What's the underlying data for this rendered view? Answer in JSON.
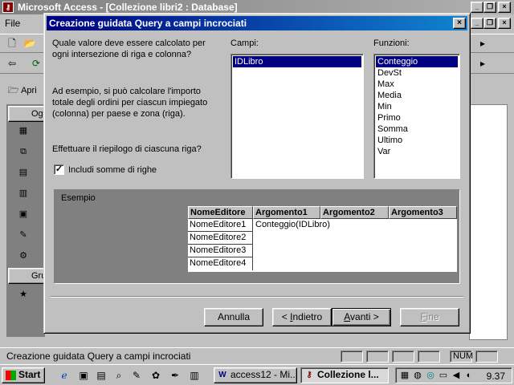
{
  "app": {
    "title": "Microsoft Access - [Collezione libri2 : Database]",
    "menu_file": "File",
    "open_label": "Apri",
    "obj_header": "Ogg",
    "groups_header": "Gru",
    "objects": [
      "T",
      "Q",
      "M",
      "R",
      "P",
      "M",
      "M"
    ],
    "group_item": "P",
    "status_text": "Creazione guidata Query a campi incrociati",
    "status_num": "NUM"
  },
  "wizard": {
    "title": "Creazione guidata Query a campi incrociati",
    "question": "Quale valore deve essere calcolato per ogni intersezione di riga e colonna?",
    "example_text": "Ad esempio, si può calcolare l'importo totale degli ordini per ciascun impiegato (colonna) per paese e zona (riga).",
    "summary_question": "Effettuare il riepilogo di ciascuna riga?",
    "checkbox_label": "Includi somme di righe",
    "checkbox_checked": true,
    "fields_label": "Campi:",
    "fields": [
      "IDLibro"
    ],
    "functions_label": "Funzioni:",
    "functions": [
      "Conteggio",
      "DevSt",
      "Max",
      "Media",
      "Min",
      "Primo",
      "Somma",
      "Ultimo",
      "Var"
    ],
    "example_label": "Esempio",
    "table_headers": [
      "NomeEditore",
      "Argomento1",
      "Argomento2",
      "Argomento3"
    ],
    "table_rows": [
      "NomeEditore1",
      "NomeEditore2",
      "NomeEditore3",
      "NomeEditore4"
    ],
    "table_value": "Conteggio(IDLibro)",
    "buttons": {
      "cancel": "Annulla",
      "back": "< Indietro",
      "next": "Avanti >",
      "finish": "Fine"
    }
  },
  "taskbar": {
    "start": "Start",
    "tasks": [
      "access12 - Mi...",
      "Collezione l..."
    ],
    "clock": "9.37"
  }
}
